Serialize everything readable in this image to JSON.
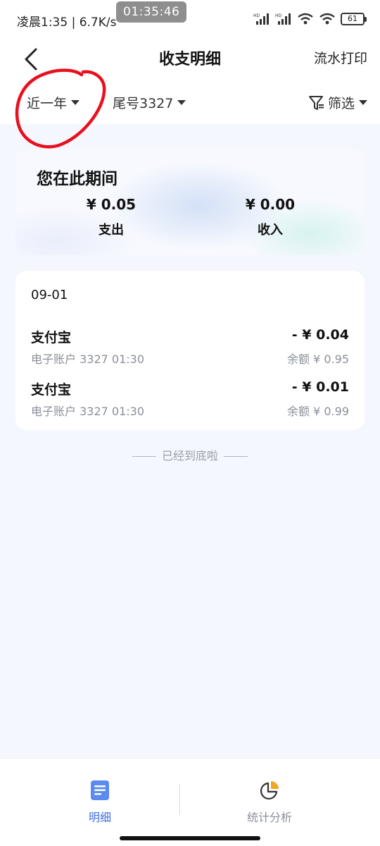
{
  "status_bar": {
    "left_text": "凌晨1:35 | 6.7K/s",
    "center_time": "01:35:46",
    "battery": "61"
  },
  "nav": {
    "title": "收支明细",
    "action": "流水打印"
  },
  "filters": {
    "period": "近一年",
    "account": "尾号3327",
    "filter": "筛选"
  },
  "summary": {
    "title": "您在此期间",
    "expense_amount": "¥ 0.05",
    "expense_label": "支出",
    "income_amount": "¥ 0.00",
    "income_label": "收入"
  },
  "transactions": {
    "date": "09-01",
    "items": [
      {
        "name": "支付宝",
        "sub": "电子账户 3327 01:30",
        "amount": "- ¥ 0.04",
        "balance": "余额 ¥ 0.95"
      },
      {
        "name": "支付宝",
        "sub": "电子账户 3327 01:30",
        "amount": "- ¥ 0.01",
        "balance": "余额 ¥ 0.99"
      }
    ]
  },
  "end_note": "已经到底啦",
  "tabs": [
    {
      "label": "明细",
      "active": true
    },
    {
      "label": "统计分析",
      "active": false
    }
  ],
  "colors": {
    "accent": "#3d6fe8",
    "annotation": "#e8101e",
    "tab_inactive": "#8a8f99"
  }
}
